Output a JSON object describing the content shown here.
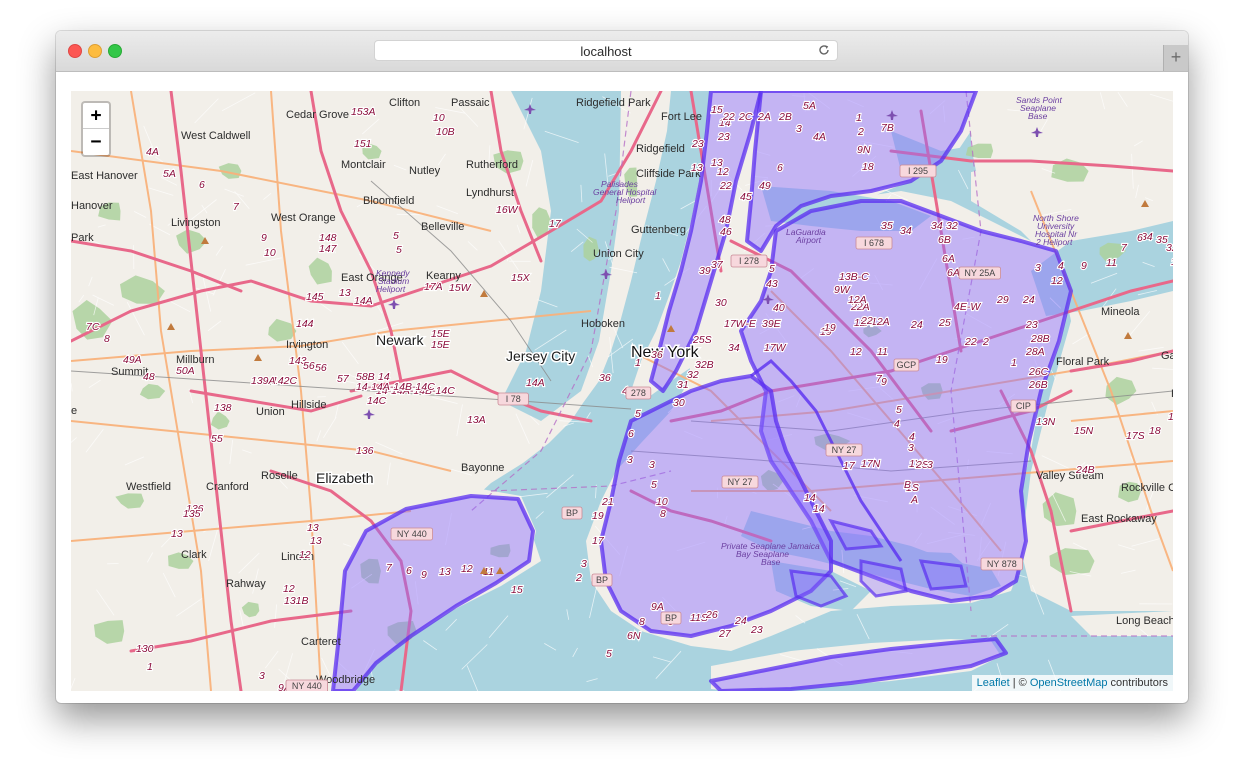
{
  "window": {
    "url": "localhost"
  },
  "map": {
    "zoom_in_label": "+",
    "zoom_out_label": "−",
    "attribution": {
      "leaflet": "Leaflet",
      "separator": " | © ",
      "osm": "OpenStreetMap",
      "contributors": " contributors"
    },
    "colors": {
      "water": "#aad3df",
      "land": "#f2efe9",
      "park": "#add19e",
      "motorway": "#e8688a",
      "trunk": "#f9b27c",
      "overlay_fill": "#8c6cff",
      "overlay_stroke": "#5a2ef0"
    },
    "places": [
      {
        "name": "Clifton",
        "kind": "town"
      },
      {
        "name": "Passaic",
        "kind": "town"
      },
      {
        "name": "Ridgefield Park",
        "kind": "town"
      },
      {
        "name": "Fort Lee",
        "kind": "town"
      },
      {
        "name": "Cedar Grove",
        "kind": "town"
      },
      {
        "name": "West Caldwell",
        "kind": "town"
      },
      {
        "name": "Ridgefield",
        "kind": "town"
      },
      {
        "name": "Montclair",
        "kind": "town"
      },
      {
        "name": "Nutley",
        "kind": "town"
      },
      {
        "name": "Rutherford",
        "kind": "town"
      },
      {
        "name": "Cliffside Park",
        "kind": "town"
      },
      {
        "name": "East Hanover",
        "kind": "town"
      },
      {
        "name": "Hanover",
        "kind": "town"
      },
      {
        "name": "Bloomfield",
        "kind": "town"
      },
      {
        "name": "Lyndhurst",
        "kind": "town"
      },
      {
        "name": "Livingston",
        "kind": "town"
      },
      {
        "name": "West Orange",
        "kind": "town"
      },
      {
        "name": "Belleville",
        "kind": "town"
      },
      {
        "name": "Guttenberg",
        "kind": "town"
      },
      {
        "name": "Park",
        "kind": "town"
      },
      {
        "name": "Union City",
        "kind": "town"
      },
      {
        "name": "Kearny",
        "kind": "town"
      },
      {
        "name": "East Orange",
        "kind": "town"
      },
      {
        "name": "Hoboken",
        "kind": "town"
      },
      {
        "name": "Newark",
        "kind": "city"
      },
      {
        "name": "Irvington",
        "kind": "town"
      },
      {
        "name": "New York",
        "kind": "big"
      },
      {
        "name": "Jersey City",
        "kind": "city"
      },
      {
        "name": "Summit",
        "kind": "town"
      },
      {
        "name": "Millburn",
        "kind": "town"
      },
      {
        "name": "Hillside",
        "kind": "town"
      },
      {
        "name": "Union",
        "kind": "town"
      },
      {
        "name": "Roselle",
        "kind": "town"
      },
      {
        "name": "Elizabeth",
        "kind": "city"
      },
      {
        "name": "Bayonne",
        "kind": "town"
      },
      {
        "name": "Westfield",
        "kind": "town"
      },
      {
        "name": "Cranford",
        "kind": "town"
      },
      {
        "name": "Clark",
        "kind": "town"
      },
      {
        "name": "Linden",
        "kind": "town"
      },
      {
        "name": "Rahway",
        "kind": "town"
      },
      {
        "name": "Carteret",
        "kind": "town"
      },
      {
        "name": "Woodbridge",
        "kind": "town"
      },
      {
        "name": "Mineola",
        "kind": "town"
      },
      {
        "name": "Garden Ci",
        "kind": "town"
      },
      {
        "name": "Floral Park",
        "kind": "town"
      },
      {
        "name": "Hem",
        "kind": "town"
      },
      {
        "name": "Valley Stream",
        "kind": "town"
      },
      {
        "name": "Rockville Cen",
        "kind": "town"
      },
      {
        "name": "East Rockaway",
        "kind": "town"
      },
      {
        "name": "Long Beach",
        "kind": "town"
      },
      {
        "name": "e",
        "kind": "town"
      }
    ],
    "poi_labels": [
      "Sands Point",
      "Seaplane",
      "Base",
      "North Shore",
      "University",
      "Hospital Nr",
      "2 Heliport",
      "Palisades",
      "General Hospital",
      "Heliport",
      "Kennedy",
      "Stadium",
      "Heliport",
      "Private Seaplane Jamaica",
      "Bay Seaplane",
      "Base",
      "LaGuardia",
      "Airport"
    ],
    "routes": [
      "153A",
      "10",
      "10B",
      "151",
      "4A",
      "5A",
      "6",
      "7",
      "9",
      "10",
      "148",
      "147",
      "145",
      "13",
      "14A",
      "5",
      "5",
      "16W",
      "17",
      "15X",
      "15W",
      "17A",
      "15E",
      "15E",
      "144",
      "143",
      "142C",
      "139A",
      "138",
      "55",
      "56",
      "56",
      "57",
      "58B",
      "14",
      "14-14A-14B-14C",
      "14-14A-14B-14C",
      "14C",
      "14A",
      "13A",
      "136",
      "136",
      "135",
      "13",
      "13",
      "13",
      "12",
      "12",
      "131B",
      "130",
      "1",
      "3",
      "9A",
      "49A",
      "50A",
      "7C",
      "8",
      "48",
      "15",
      "14",
      "23",
      "23",
      "13",
      "13",
      "12",
      "22",
      "22",
      "2C",
      "2A",
      "2B",
      "3",
      "4A",
      "5A",
      "6",
      "49",
      "45",
      "48",
      "46",
      "1",
      "2",
      "7B",
      "9N",
      "18",
      "35",
      "34",
      "34",
      "32",
      "6B",
      "6A",
      "6A",
      "5",
      "43",
      "40",
      "39E",
      "17W-E",
      "17W",
      "19",
      "34",
      "32B",
      "32",
      "31",
      "30",
      "19",
      "22A",
      "12A",
      "12A",
      "24",
      "25",
      "4E-W",
      "29",
      "24",
      "23",
      "28B",
      "28A",
      "22",
      "2",
      "1",
      "26C",
      "26B",
      "19",
      "12",
      "11",
      "7",
      "9",
      "5",
      "4",
      "4",
      "3",
      "1W",
      "1S",
      "2S",
      "3",
      "B",
      "A",
      "17",
      "17N",
      "13N",
      "15N",
      "17S",
      "18",
      "19N",
      "24B",
      "14",
      "14",
      "13B-C",
      "9W",
      "12A",
      "22",
      "21",
      "19",
      "17",
      "3",
      "2",
      "5",
      "6N",
      "8",
      "9A",
      "9",
      "11S",
      "26",
      "27",
      "24",
      "23",
      "4",
      "5",
      "6",
      "3",
      "3",
      "5",
      "10",
      "8",
      "1",
      "1",
      "36",
      "36",
      "37",
      "39",
      "30",
      "25S",
      "34",
      "35",
      "32",
      "32",
      "13",
      "12",
      "11",
      "9",
      "7",
      "6",
      "3",
      "4",
      "15",
      "11",
      "12",
      "13",
      "9",
      "6",
      "7"
    ],
    "shields": [
      "I 278",
      "I 678",
      "I 295",
      "NY 25A",
      "GCP",
      "I 78",
      "NY 27",
      "NY 27",
      "CIP",
      "NY 440",
      "NY 440",
      "BP",
      "BP",
      "BP",
      "NY 878",
      "278"
    ]
  }
}
